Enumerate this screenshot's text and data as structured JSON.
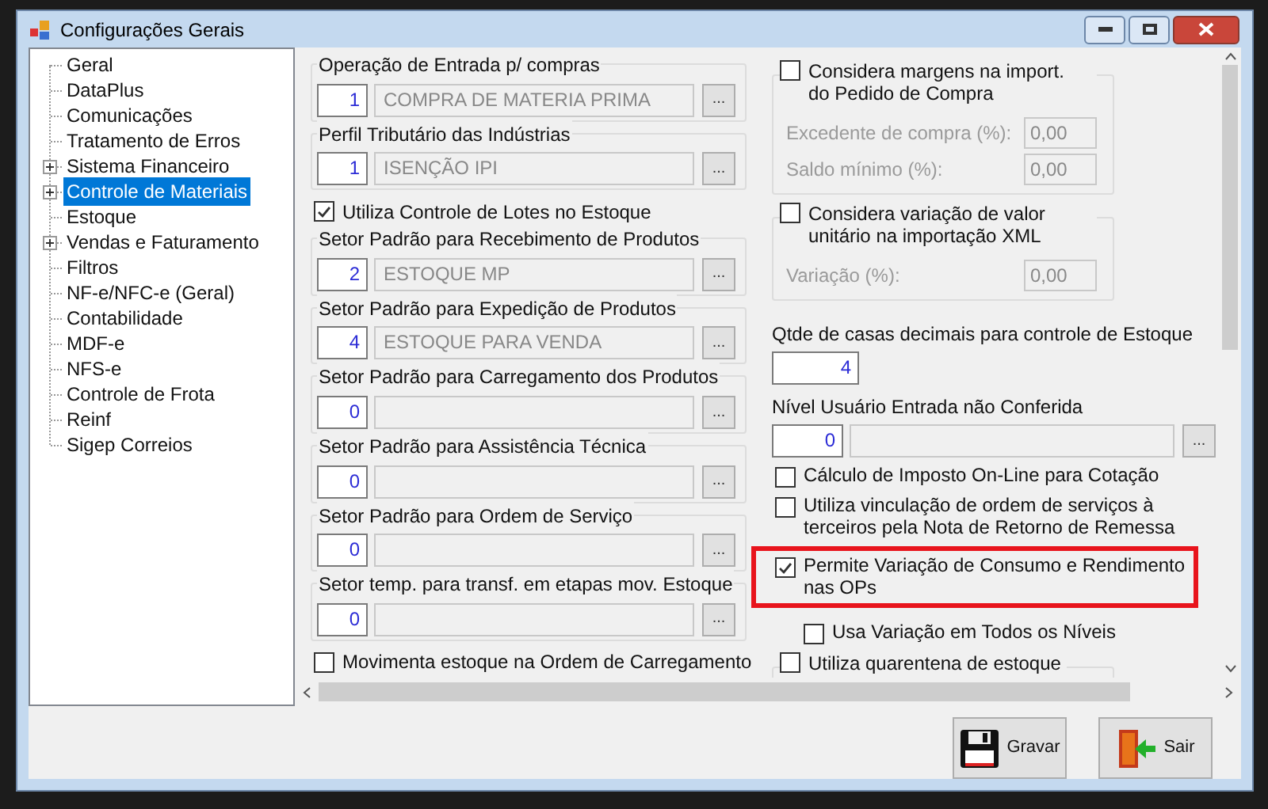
{
  "window": {
    "title": "Configurações Gerais"
  },
  "tree": {
    "items": [
      {
        "label": "Geral",
        "selected": false,
        "expandable": false
      },
      {
        "label": "DataPlus",
        "selected": false,
        "expandable": false
      },
      {
        "label": "Comunicações",
        "selected": false,
        "expandable": false
      },
      {
        "label": "Tratamento de Erros",
        "selected": false,
        "expandable": false
      },
      {
        "label": "Sistema Financeiro",
        "selected": false,
        "expandable": true
      },
      {
        "label": "Controle de Materiais",
        "selected": true,
        "expandable": true
      },
      {
        "label": "Estoque",
        "selected": false,
        "expandable": false
      },
      {
        "label": "Vendas e Faturamento",
        "selected": false,
        "expandable": true
      },
      {
        "label": "Filtros",
        "selected": false,
        "expandable": false
      },
      {
        "label": "NF-e/NFC-e (Geral)",
        "selected": false,
        "expandable": false
      },
      {
        "label": "Contabilidade",
        "selected": false,
        "expandable": false
      },
      {
        "label": "MDF-e",
        "selected": false,
        "expandable": false
      },
      {
        "label": "NFS-e",
        "selected": false,
        "expandable": false
      },
      {
        "label": "Controle de Frota",
        "selected": false,
        "expandable": false
      },
      {
        "label": "Reinf",
        "selected": false,
        "expandable": false
      },
      {
        "label": "Sigep Correios",
        "selected": false,
        "expandable": false
      }
    ]
  },
  "left_column": [
    {
      "kind": "lookup",
      "label": "Operação de Entrada p/ compras",
      "code": "1",
      "value": "COMPRA DE MATERIA PRIMA",
      "button": "..."
    },
    {
      "kind": "lookup",
      "label": "Perfil Tributário das Indústrias",
      "code": "1",
      "value": "ISENÇÃO IPI",
      "button": "..."
    },
    {
      "kind": "checkbox",
      "label": "Utiliza Controle de Lotes no Estoque",
      "checked": true
    },
    {
      "kind": "lookup",
      "label": "Setor Padrão para Recebimento de Produtos",
      "code": "2",
      "value": "ESTOQUE MP",
      "button": "..."
    },
    {
      "kind": "lookup",
      "label": "Setor Padrão para Expedição de Produtos",
      "code": "4",
      "value": "ESTOQUE PARA VENDA",
      "button": "..."
    },
    {
      "kind": "lookup",
      "label": "Setor Padrão para Carregamento dos Produtos",
      "code": "0",
      "button": "..."
    },
    {
      "kind": "lookup",
      "label": "Setor Padrão para Assistência Técnica",
      "code": "0",
      "button": "..."
    },
    {
      "kind": "lookup",
      "label": "Setor Padrão para Ordem de Serviço",
      "code": "0",
      "button": "..."
    },
    {
      "kind": "lookup",
      "label": "Setor temp. para transf. em etapas mov. Estoque",
      "code": "0",
      "button": "..."
    },
    {
      "kind": "checkbox",
      "label": "Movimenta estoque na Ordem de Carregamento",
      "checked": false
    }
  ],
  "right_column": [
    {
      "kind": "checkgroup",
      "label": "Considera margens na import. do Pedido de Compra",
      "checked": false,
      "fields": [
        {
          "label": "Excedente de compra (%):",
          "value": "0,00"
        },
        {
          "label": "Saldo mínimo (%):",
          "value": "0,00"
        }
      ]
    },
    {
      "kind": "checkgroup",
      "label": "Considera variação de valor unitário na importação XML",
      "checked": false,
      "fields": [
        {
          "label": "Variação (%):",
          "value": "0,00"
        }
      ]
    },
    {
      "kind": "number",
      "label": "Qtde de casas decimais para controle de Estoque",
      "code": "4"
    },
    {
      "kind": "lookup",
      "label": "Nível Usuário Entrada não Conferida",
      "code": "0",
      "button": "..."
    },
    {
      "kind": "checkbox",
      "label": "Cálculo de Imposto On-Line para Cotação",
      "checked": false
    },
    {
      "kind": "checkbox",
      "label": "Utiliza vinculação de ordem de serviços à terceiros pela Nota de Retorno de Remessa",
      "checked": false
    },
    {
      "kind": "checkbox",
      "label": "Permite Variação de Consumo e Rendimento nas OPs",
      "checked": true,
      "highlighted": true,
      "children": [
        {
          "label": "Usa Variação em Todos os Níveis",
          "checked": false
        }
      ]
    },
    {
      "kind": "checkgroup",
      "label": "Utiliza quarentena de estoque",
      "checked": false
    }
  ],
  "buttons": [
    {
      "label": "Gravar",
      "kind": "save"
    },
    {
      "label": "Sair",
      "kind": "exit"
    }
  ]
}
